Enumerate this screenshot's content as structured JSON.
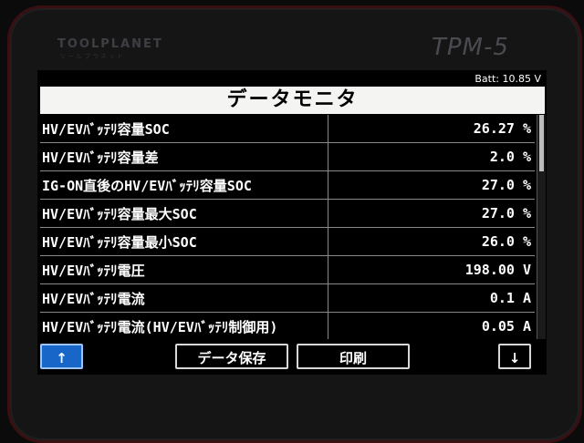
{
  "device": {
    "brand": "TOOLPLANET",
    "brand_sub": "ツールプラネット",
    "model": "TPM-5"
  },
  "status": {
    "battery": "Batt: 10.85 V"
  },
  "screen": {
    "title": "データモニタ"
  },
  "rows": [
    {
      "label": "HV/EVﾊﾞｯﾃﾘ容量SOC",
      "value": "26.27 %"
    },
    {
      "label": "HV/EVﾊﾞｯﾃﾘ容量差",
      "value": "2.0 %"
    },
    {
      "label": "IG-ON直後のHV/EVﾊﾞｯﾃﾘ容量SOC",
      "value": "27.0 %"
    },
    {
      "label": "HV/EVﾊﾞｯﾃﾘ容量最大SOC",
      "value": "27.0 %"
    },
    {
      "label": "HV/EVﾊﾞｯﾃﾘ容量最小SOC",
      "value": "26.0 %"
    },
    {
      "label": "HV/EVﾊﾞｯﾃﾘ電圧",
      "value": "198.00 V"
    },
    {
      "label": "HV/EVﾊﾞｯﾃﾘ電流",
      "value": "0.1 A"
    },
    {
      "label": "HV/EVﾊﾞｯﾃﾘ電流(HV/EVﾊﾞｯﾃﾘ制御用)",
      "value": "0.05 A"
    }
  ],
  "scroll": {
    "position": 0.0,
    "visible_fraction": 0.25
  },
  "buttons": {
    "up": "↑",
    "save": "データ保存",
    "print": "印刷",
    "down": "↓"
  },
  "colors": {
    "accent": "#1766c8",
    "title_bg": "#f4f4f2"
  }
}
